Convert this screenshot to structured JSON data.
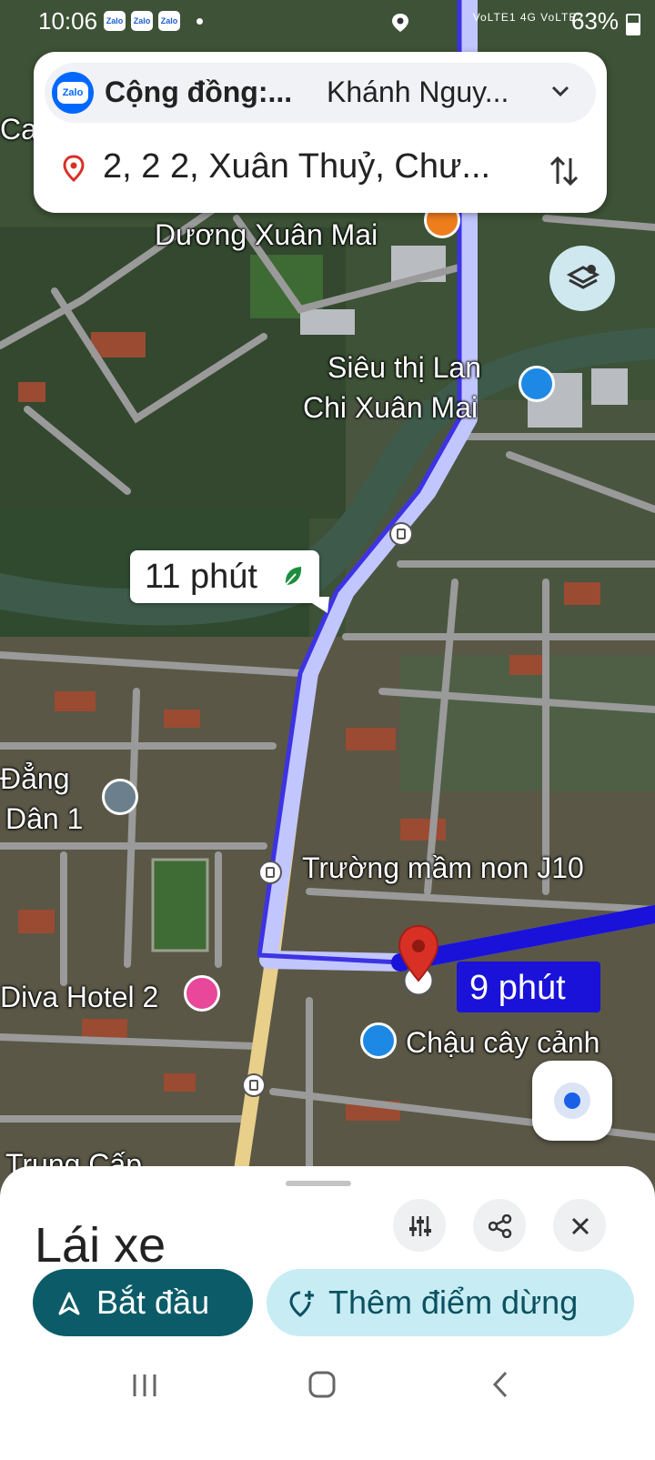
{
  "status": {
    "time": "10:06",
    "zalo": "Zalo",
    "signal_info": "VoLTE1 4G VoLTE2",
    "battery": "63%"
  },
  "search": {
    "origin_app": "Zalo",
    "origin_a": "Cộng đồng:...",
    "origin_b": "Khánh Nguy...",
    "destination": "2, 2 2, Xuân Thuỷ, Chư..."
  },
  "map": {
    "labels": {
      "ca": "Ca",
      "duong": "Dương Xuân Mai",
      "sieuthi1": "Siêu thị Lan",
      "sieuthi2": "Chi Xuân Mai",
      "dang": "Đẳng",
      "dan": "Dân 1",
      "truong": "Trường mầm non J10",
      "diva": "Diva Hotel 2",
      "chau": "Chậu cây cảnh",
      "trung": "Trung Cấp"
    },
    "eta_main": "11 phút",
    "eta_alt": "9 phút",
    "route_color": "#3d33e3",
    "alt_route_color": "#1a12d8"
  },
  "sheet": {
    "title": "Lái xe",
    "start": "Bắt đầu",
    "add_stop": "Thêm điểm dừng"
  },
  "colors": {
    "start_bg": "#0b5c68",
    "stop_bg": "#c7ecf4",
    "pin": "#d93025"
  }
}
